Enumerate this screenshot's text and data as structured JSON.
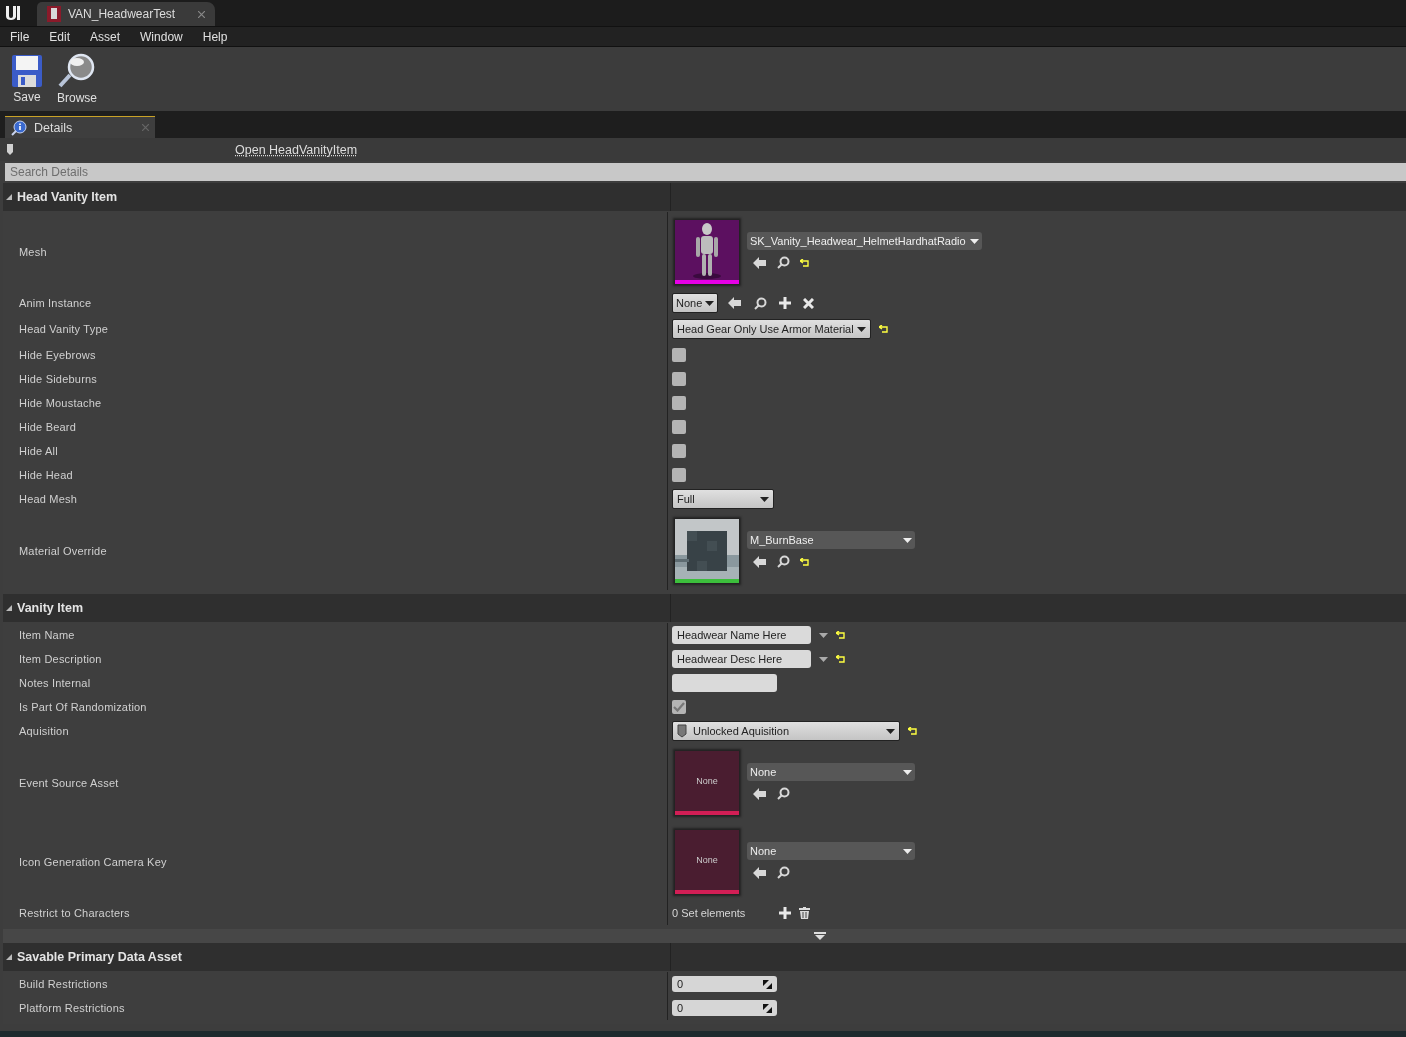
{
  "window": {
    "tab_title": "VAN_HeadwearTest"
  },
  "menu": [
    "File",
    "Edit",
    "Asset",
    "Window",
    "Help"
  ],
  "toolbar": [
    {
      "kind": "save",
      "label": "Save"
    },
    {
      "kind": "browse",
      "label": "Browse"
    }
  ],
  "panel_tab": {
    "label": "Details"
  },
  "open_link": "Open HeadVanityItem",
  "search": {
    "placeholder": "Search Details"
  },
  "sections": [
    {
      "title": "Head Vanity Item",
      "rows": [
        {
          "label": "Mesh",
          "kind": "asset",
          "thumb": {
            "kind": "mesh",
            "color": "#e600e6"
          },
          "value": "SK_Vanity_Headwear_HelmetHardhatRadio",
          "actions": [
            {
              "kind": "use"
            },
            {
              "kind": "browse"
            },
            {
              "kind": "reset"
            }
          ]
        },
        {
          "label": "Anim Instance",
          "kind": "class",
          "value": "None",
          "actions": [
            {
              "kind": "use"
            },
            {
              "kind": "browse"
            },
            {
              "kind": "add"
            },
            {
              "kind": "clear"
            }
          ]
        },
        {
          "label": "Head Vanity Type",
          "kind": "enum",
          "value": "Head Gear Only Use Armor Material",
          "reset": true
        },
        {
          "label": "Hide Eyebrows",
          "kind": "checkbox",
          "checked": false
        },
        {
          "label": "Hide Sideburns",
          "kind": "checkbox",
          "checked": false
        },
        {
          "label": "Hide Moustache",
          "kind": "checkbox",
          "checked": false
        },
        {
          "label": "Hide Beard",
          "kind": "checkbox",
          "checked": false
        },
        {
          "label": "Hide All",
          "kind": "checkbox",
          "checked": false
        },
        {
          "label": "Hide Head",
          "kind": "checkbox",
          "checked": false
        },
        {
          "label": "Head Mesh",
          "kind": "enum_wide",
          "value": "Full",
          "reset": false
        },
        {
          "label": "Material Override",
          "kind": "asset",
          "thumb": {
            "kind": "material",
            "color": "#3cbf3c"
          },
          "value": "M_BurnBase",
          "actions": [
            {
              "kind": "use"
            },
            {
              "kind": "browse"
            },
            {
              "kind": "reset"
            }
          ]
        }
      ]
    },
    {
      "title": "Vanity Item",
      "rows": [
        {
          "label": "Item Name",
          "kind": "text",
          "value": "Headwear Name Here",
          "reset": true
        },
        {
          "label": "Item Description",
          "kind": "text",
          "value": "Headwear Desc Here",
          "reset": true
        },
        {
          "label": "Notes Internal",
          "kind": "empty_text"
        },
        {
          "label": "Is Part Of Randomization",
          "kind": "checkbox",
          "checked": true
        },
        {
          "label": "Aquisition",
          "kind": "enum_asset",
          "value": "Unlocked Aquisition",
          "reset": true
        },
        {
          "label": "Event Source Asset",
          "kind": "asset",
          "thumb": {
            "kind": "none",
            "color": "#d21e55",
            "text": "None"
          },
          "value": "None",
          "actions": [
            {
              "kind": "use"
            },
            {
              "kind": "browse"
            }
          ]
        },
        {
          "label": "Icon Generation Camera Key",
          "kind": "asset",
          "thumb": {
            "kind": "none",
            "color": "#d21e55",
            "text": "None"
          },
          "value": "None",
          "actions": [
            {
              "kind": "use"
            },
            {
              "kind": "browse"
            }
          ]
        },
        {
          "label": "Restrict to Characters",
          "kind": "set",
          "value": "0 Set elements"
        }
      ]
    },
    {
      "title": "Savable Primary Data Asset",
      "rows": [
        {
          "label": "Build Restrictions",
          "kind": "number",
          "value": "0"
        },
        {
          "label": "Platform Restrictions",
          "kind": "number",
          "value": "0"
        }
      ]
    }
  ]
}
